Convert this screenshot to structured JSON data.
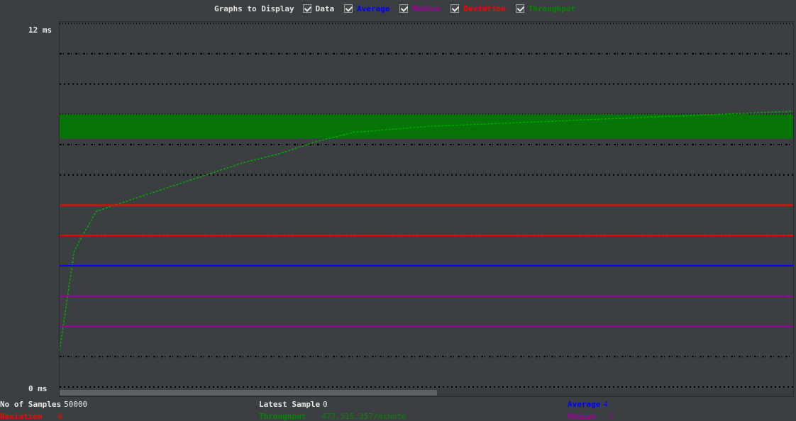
{
  "legend": {
    "title": "Graphs to Display",
    "items": [
      {
        "label": "Data",
        "color": "#e6e6e6",
        "checked": true
      },
      {
        "label": "Average",
        "color": "#0000ff",
        "checked": true
      },
      {
        "label": "Median",
        "color": "#a000a0",
        "checked": true
      },
      {
        "label": "Deviation",
        "color": "#ff0000",
        "checked": true
      },
      {
        "label": "Throughput",
        "color": "#008800",
        "checked": true
      }
    ]
  },
  "axis": {
    "y_max_label": "12 ms",
    "y_min_label": "0 ms"
  },
  "stats": {
    "samples_label": "No of Samples",
    "samples_value": "50000",
    "latest_label": "Latest Sample",
    "latest_value": "0",
    "average_label": "Average",
    "average_value": "4",
    "deviation_label": "Deviation",
    "deviation_value": "6",
    "throughput_label": "Throughput",
    "throughput_value": "472,515.357/minute",
    "median_label": "Median",
    "median_value": "2"
  },
  "chart_data": {
    "type": "scatter",
    "title": "",
    "xlabel": "",
    "ylabel": "",
    "ylim": [
      0,
      12
    ],
    "grid": false,
    "legend_position": "top",
    "data_levels_ms": [
      0,
      1,
      3,
      4,
      5,
      6,
      7,
      8,
      9,
      10,
      11,
      12
    ],
    "series": [
      {
        "name": "Average",
        "color": "#0000ff",
        "values": [
          4
        ]
      },
      {
        "name": "Median",
        "color": "#a000a0",
        "values": [
          2,
          3
        ]
      },
      {
        "name": "Deviation",
        "color": "#ff0000",
        "values": [
          5,
          6
        ]
      },
      {
        "name": "Throughput",
        "color": "#008800",
        "x_fraction": [
          0.0,
          0.02,
          0.05,
          0.1,
          0.15,
          0.2,
          0.25,
          0.3,
          0.35,
          0.4,
          0.5,
          0.6,
          0.7,
          0.8,
          0.9,
          1.0
        ],
        "values": [
          1.2,
          4.5,
          5.8,
          6.2,
          6.6,
          7.0,
          7.4,
          7.7,
          8.1,
          8.4,
          8.6,
          8.7,
          8.8,
          8.9,
          9.0,
          9.1
        ]
      }
    ]
  }
}
